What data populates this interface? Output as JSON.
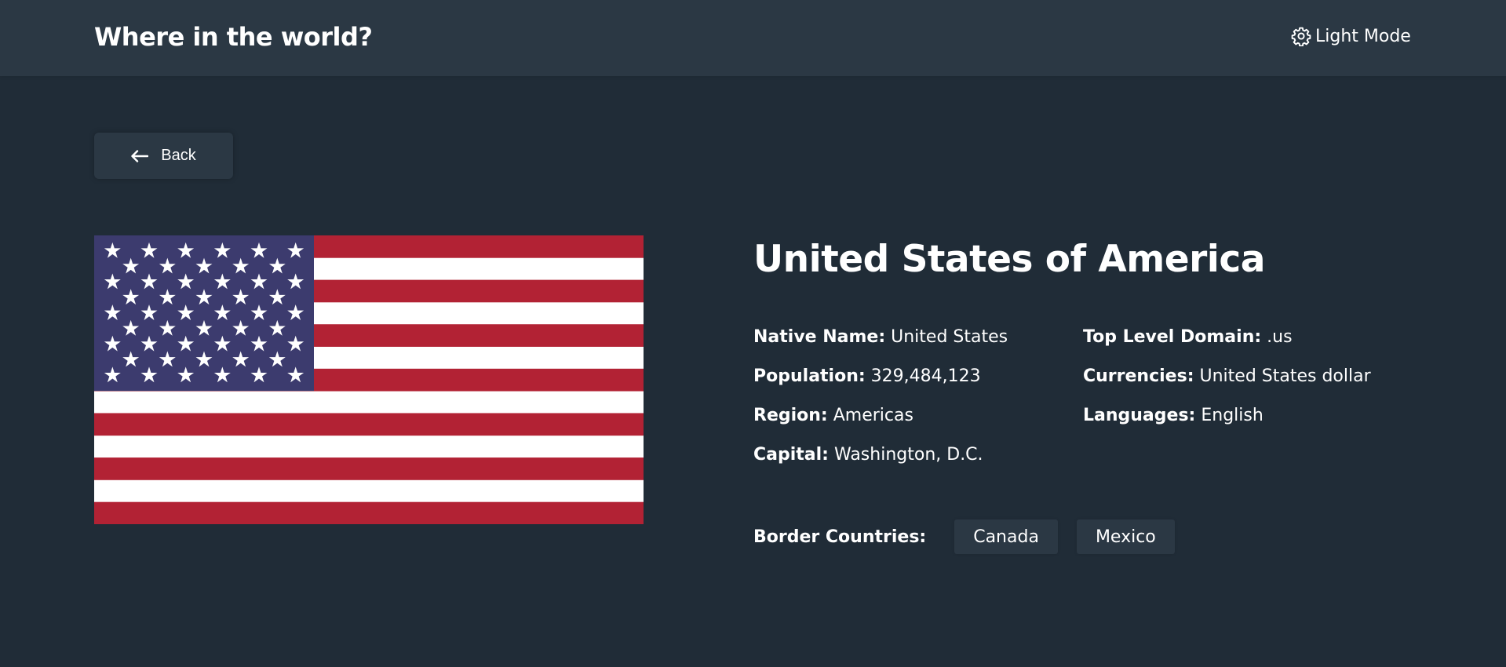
{
  "header": {
    "title": "Where in the world?",
    "mode_toggle": {
      "label": "Light Mode",
      "icon": "gear-icon"
    }
  },
  "back_button": {
    "label": "Back",
    "icon": "arrow-left-icon"
  },
  "flag": {
    "icon": "us-flag",
    "stripe_red": "#b22234",
    "stripe_white": "#ffffff",
    "canton": "#3c3b6e"
  },
  "country": {
    "name": "United States of America",
    "facts_left": [
      {
        "label": "Native Name:",
        "value": "United States"
      },
      {
        "label": "Population:",
        "value": "329,484,123"
      },
      {
        "label": "Region:",
        "value": "Americas"
      },
      {
        "label": "Capital:",
        "value": "Washington, D.C."
      }
    ],
    "facts_right": [
      {
        "label": "Top Level Domain:",
        "value": ".us"
      },
      {
        "label": "Currencies:",
        "value": "United States dollar"
      },
      {
        "label": "Languages:",
        "value": "English"
      }
    ],
    "border_label": "Border Countries:",
    "borders": [
      "Canada",
      "Mexico"
    ]
  },
  "colors": {
    "background": "#202c37",
    "elements": "#2b3844",
    "text": "#ffffff"
  }
}
